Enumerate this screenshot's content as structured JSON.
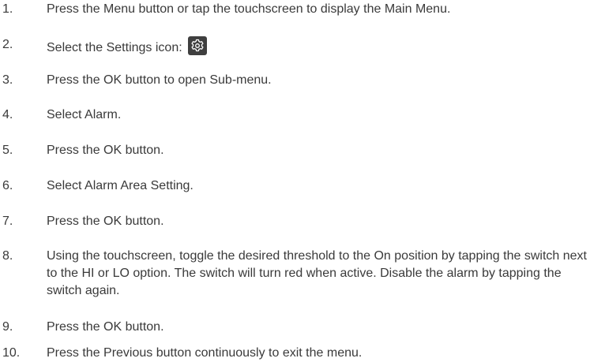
{
  "steps": [
    {
      "number": "1.",
      "text": "Press the Menu button or tap the touchscreen to display the Main Menu."
    },
    {
      "number": "2.",
      "text": "Select the Settings icon:",
      "icon": "settings-icon"
    },
    {
      "number": "3.",
      "text": "Press the OK button to open Sub-menu."
    },
    {
      "number": "4.",
      "text": "Select Alarm."
    },
    {
      "number": "5.",
      "text": "Press the OK button."
    },
    {
      "number": "6.",
      "text": "Select Alarm Area Setting."
    },
    {
      "number": "7.",
      "text": "Press the OK button."
    },
    {
      "number": "8.",
      "text": "Using the touchscreen, toggle the desired threshold to the On position by tapping the switch next to the HI or LO option. The switch will turn red when active. Disable the alarm by tapping the switch again."
    },
    {
      "number": "9.",
      "text": "Press the OK button."
    },
    {
      "number": "10.",
      "text": "Press the Previous button continuously to exit the menu."
    }
  ]
}
